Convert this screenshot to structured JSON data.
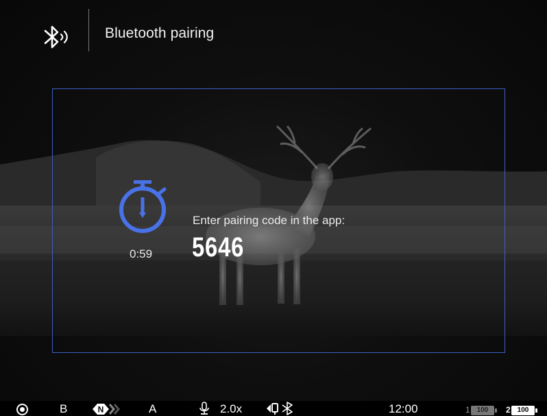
{
  "header": {
    "title": "Bluetooth pairing",
    "icon": "bluetooth-broadcast-icon"
  },
  "dialog": {
    "timer_icon": "stopwatch-icon",
    "countdown": "0:59",
    "prompt": "Enter pairing code in the app:",
    "pairing_code": "5646",
    "border_color": "#3e5fc2",
    "icon_color": "#4a72e8"
  },
  "background": {
    "image": "thermal-deer-scene"
  },
  "statusbar": {
    "record_icon": "record-icon",
    "mode": "B",
    "nuc_icon": "nuc-calibration-icon",
    "nuc_label": "N",
    "amplification": "A",
    "mic_icon": "microphone-icon",
    "zoom": "2.0x",
    "wifi_icon": "wifi-icon",
    "bluetooth_icon": "bluetooth-icon",
    "time": "12:00",
    "battery1": {
      "label": "1",
      "value": "100"
    },
    "battery2": {
      "label": "2",
      "value": "100"
    }
  }
}
